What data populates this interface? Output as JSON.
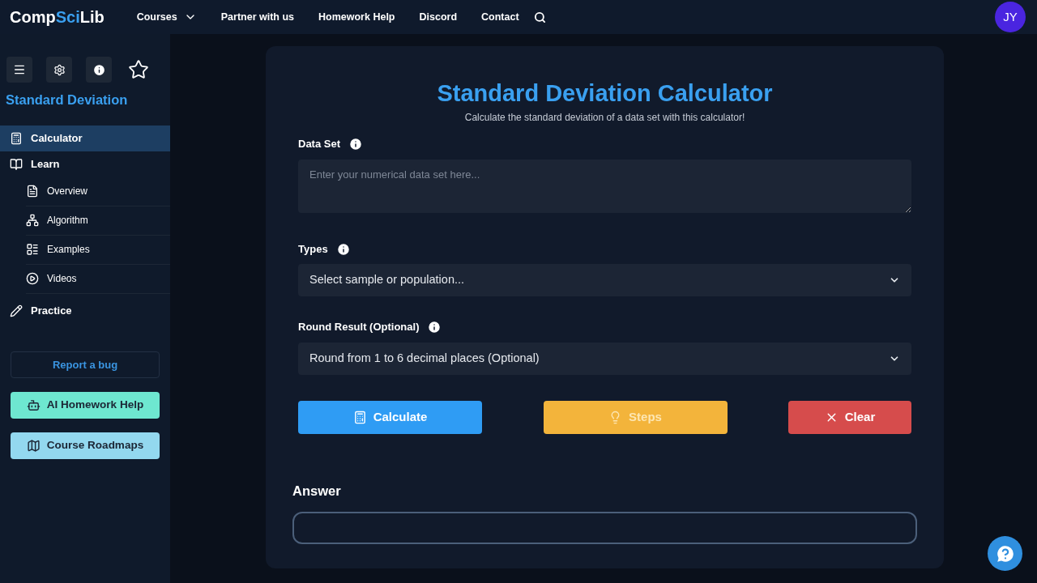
{
  "nav": {
    "logo": [
      {
        "text": "Comp",
        "accent": false
      },
      {
        "text": "Sci",
        "accent": true
      },
      {
        "text": "Lib",
        "accent": false
      }
    ],
    "links": [
      {
        "label": "Courses",
        "dropdown": true
      },
      {
        "label": "Partner with us",
        "dropdown": false
      },
      {
        "label": "Homework Help",
        "dropdown": false
      },
      {
        "label": "Discord",
        "dropdown": false
      },
      {
        "label": "Contact",
        "dropdown": false
      }
    ],
    "avatar": "JY"
  },
  "sidebar": {
    "title": "Standard Deviation",
    "items": [
      {
        "label": "Calculator",
        "selected": true
      },
      {
        "label": "Learn",
        "selected": false,
        "children": [
          {
            "label": "Overview",
            "selected": false
          },
          {
            "label": "Algorithm",
            "selected": false
          },
          {
            "label": "Examples",
            "selected": false
          },
          {
            "label": "Videos",
            "selected": false
          }
        ]
      },
      {
        "label": "Practice",
        "selected": false
      }
    ],
    "report": "Report a bug",
    "buttons": [
      {
        "label": "AI Homework Help",
        "color": "#6ee7d0"
      },
      {
        "label": "Course Roadmaps",
        "color": "#93d8ef"
      }
    ]
  },
  "calculator": {
    "title": "Standard Deviation Calculator",
    "subtitle": "Calculate the standard deviation of a data set with this calculator!",
    "fields": [
      {
        "kind": "textarea",
        "label": "Data Set",
        "placeholder": "Enter your numerical data set here..."
      },
      {
        "kind": "select",
        "label": "Types",
        "value": "Select sample or population..."
      },
      {
        "kind": "select",
        "label": "Round Result (Optional)",
        "value": "Round from 1 to 6 decimal places (Optional)"
      }
    ],
    "buttons": [
      {
        "kind": "calculate",
        "label": "Calculate",
        "disabled": false
      },
      {
        "kind": "steps",
        "label": "Steps",
        "disabled": true
      },
      {
        "kind": "clear",
        "label": "Clear",
        "disabled": false
      }
    ],
    "answer_label": "Answer"
  }
}
